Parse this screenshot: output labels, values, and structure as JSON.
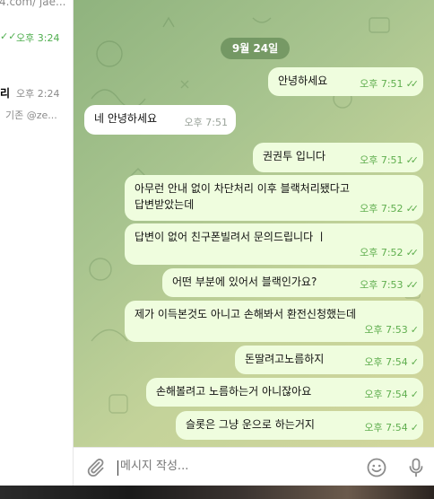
{
  "chat_list": {
    "row1_text": "4.com/  jae...",
    "row2_ticks": "✓✓",
    "row2_time": "오후 3:24",
    "row3_name": "리",
    "row3_time": "오후 2:24",
    "row3_preview": "기존 @ze..."
  },
  "chat": {
    "date": "9월 24일",
    "messages": [
      {
        "text": "안녕하세요",
        "time": "오후 7:51",
        "ticks": "✓✓"
      },
      {
        "text": "네 안녕하세요",
        "time": "오후 7:51",
        "ticks": ""
      },
      {
        "text": "권권투 입니다",
        "time": "오후 7:51",
        "ticks": "✓✓"
      },
      {
        "text": "아무런 안내 없이 차단처리 이후 블랙처리됐다고",
        "text2": "답변받았는데",
        "time": "오후 7:52",
        "ticks": "✓✓"
      },
      {
        "text": "답변이 없어 친구폰빌려서 문의드립니다 ㅣ",
        "time": "오후 7:52",
        "ticks": "✓✓"
      },
      {
        "text": "어떤 부분에 있어서 블랙인가요?",
        "time": "오후 7:53",
        "ticks": "✓✓"
      },
      {
        "text": "제가 이득본것도 아니고 손해봐서 환전신청했는데",
        "time": "오후 7:53",
        "ticks": "✓"
      },
      {
        "text": "돈딸려고노름하지",
        "time": "오후 7:54",
        "ticks": "✓"
      },
      {
        "text": "손해볼려고 노름하는거 아니잖아요",
        "time": "오후 7:54",
        "ticks": "✓"
      },
      {
        "text": "슬롯은 그냥 운으로 하는거지",
        "time": "오후 7:54",
        "ticks": "✓"
      }
    ]
  },
  "composer": {
    "placeholder": "메시지 작성..."
  },
  "colors": {
    "outgoing_bubble": "#effdde",
    "incoming_bubble": "#ffffff",
    "check_green": "#5fae4e",
    "date_pill": "#6d8a5f"
  },
  "icons": {
    "attach": "paperclip-icon",
    "emoji": "smiley-icon",
    "mic": "microphone-icon"
  }
}
